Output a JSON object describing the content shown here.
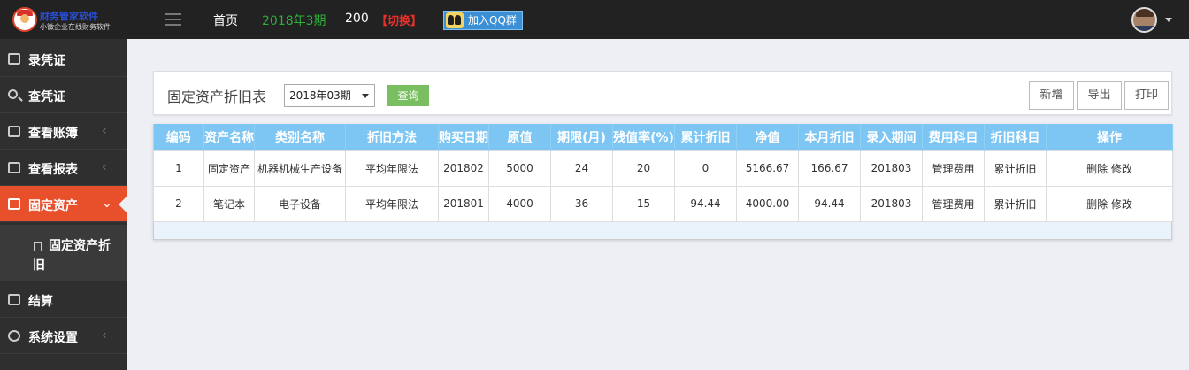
{
  "topbar": {
    "logo_title": "财务管家软件",
    "logo_subtitle": "小微企业在线财务软件",
    "home": "首页",
    "period": "2018年3期",
    "count": "200",
    "switch": "【切换】",
    "qq_button": "加入QQ群",
    "colors": {
      "period": "#2eae3a",
      "switch": "#e8302b",
      "bar": "#222222"
    }
  },
  "sidebar": {
    "items": [
      {
        "label": "录凭证",
        "icon": "edit-icon"
      },
      {
        "label": "查凭证",
        "icon": "search-icon"
      },
      {
        "label": "查看账簿",
        "icon": "book-icon",
        "chevron": "‹"
      },
      {
        "label": "查看报表",
        "icon": "bar-chart-icon",
        "chevron": "‹"
      },
      {
        "label": "固定资产",
        "icon": "bar-chart-icon",
        "chevron": "⌄",
        "active": true
      },
      {
        "label": "结算",
        "icon": "list-icon"
      },
      {
        "label": "系统设置",
        "icon": "gear-icon",
        "chevron": "‹"
      }
    ],
    "sub_item": {
      "label": "固定资产折旧",
      "icon": "document-icon"
    },
    "active_color": "#e8502c"
  },
  "toolbar": {
    "title": "固定资产折旧表",
    "period_select": "2018年03期",
    "query": "查询",
    "new": "新增",
    "export": "导出",
    "print": "打印"
  },
  "table": {
    "headers": [
      "编码",
      "资产名称",
      "类别名称",
      "折旧方法",
      "购买日期",
      "原值",
      "期限(月)",
      "残值率(%)",
      "累计折旧",
      "净值",
      "本月折旧",
      "录入期间",
      "费用科目",
      "折旧科目",
      "操作"
    ],
    "rows": [
      [
        "1",
        "固定资产",
        "机器机械生产设备",
        "平均年限法",
        "201802",
        "5000",
        "24",
        "20",
        "0",
        "5166.67",
        "166.67",
        "201803",
        "管理费用",
        "累计折旧"
      ],
      [
        "2",
        "笔记本",
        "电子设备",
        "平均年限法",
        "201801",
        "4000",
        "36",
        "15",
        "94.44",
        "4000.00",
        "94.44",
        "201803",
        "管理费用",
        "累计折旧"
      ]
    ],
    "actions": {
      "delete": "删除",
      "edit": "修改"
    },
    "header_color": "#7dc6f4"
  }
}
